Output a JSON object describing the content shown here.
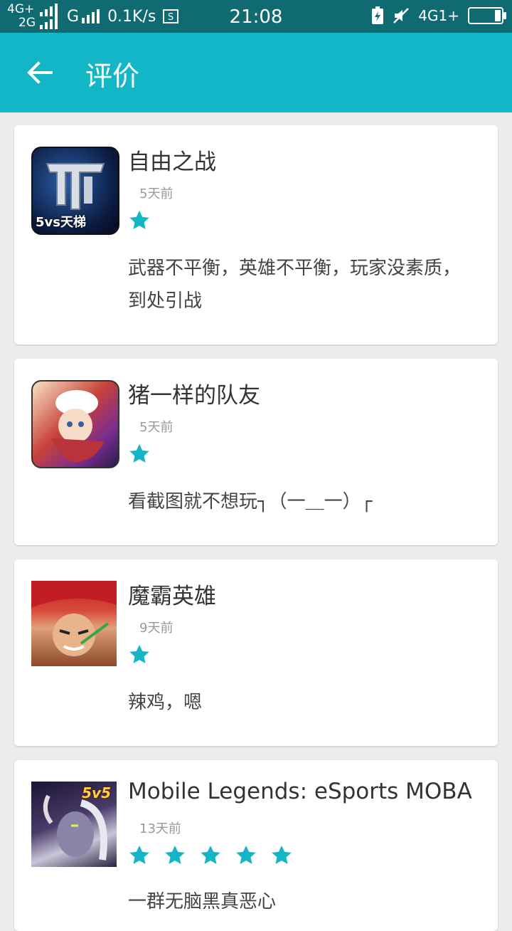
{
  "status_bar": {
    "network_top": "4G+",
    "network_bottom": "2G",
    "carrier_g": "G",
    "speed": "0.1K/s",
    "time": "21:08",
    "right_network": "4G1+"
  },
  "header": {
    "title": "评价"
  },
  "reviews": [
    {
      "app_name": "自由之战",
      "time": "5天前",
      "stars": 1,
      "comment": "武器不平衡，英雄不平衡，玩家没素质，到处引战",
      "icon_text": "5vs天梯"
    },
    {
      "app_name": "猪一样的队友",
      "time": "5天前",
      "stars": 1,
      "comment": "看截图就不想玩┐（一＿一）┌",
      "icon_text": ""
    },
    {
      "app_name": "魔霸英雄",
      "time": "9天前",
      "stars": 1,
      "comment": "辣鸡，嗯",
      "icon_text": ""
    },
    {
      "app_name": "Mobile Legends: eSports MOBA",
      "time": "13天前",
      "stars": 5,
      "comment": "一群无脑黑真恶心",
      "icon_text": "5v5"
    }
  ],
  "colors": {
    "accent": "#13b6c6",
    "status_bar": "#0f6a72",
    "star": "#13b6c6"
  }
}
